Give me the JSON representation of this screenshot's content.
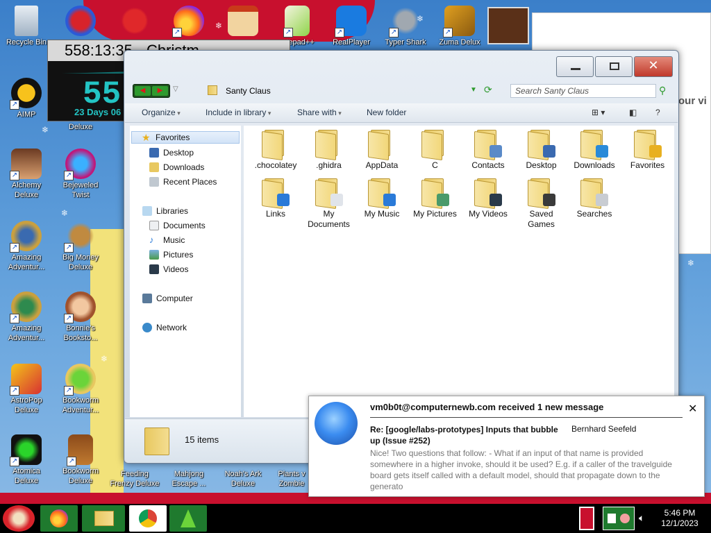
{
  "desktop": {
    "icons": [
      {
        "label": "Recycle Bin"
      },
      {
        "label": "AIMP"
      },
      {
        "label": "Alchemy Deluxe"
      },
      {
        "label": "Amazing Adventur..."
      },
      {
        "label": "Amazing Adventur..."
      },
      {
        "label": "AstroPop Deluxe"
      },
      {
        "label": "Atomica Deluxe"
      },
      {
        "label": "Bejeweled Twist"
      },
      {
        "label": "Big Money Deluxe"
      },
      {
        "label": "Bonnie's Booksto..."
      },
      {
        "label": "Bookworm Adventur..."
      },
      {
        "label": "Bookworm Deluxe"
      },
      {
        "label": "Feeding Frenzy Deluxe"
      },
      {
        "label": "Mahjong Escape ..."
      },
      {
        "label": "Noah's Ark Deluxe"
      },
      {
        "label": "Plants v Zombie"
      },
      {
        "label": "...tepad++"
      },
      {
        "label": "RealPlayer"
      },
      {
        "label": "Typer Shark"
      },
      {
        "label": "Zuma Delux"
      },
      {
        "label": "Deluxe"
      }
    ],
    "countdown": {
      "timer": "558:13:35",
      "title": "Christm",
      "big": "55",
      "days": "23 Days 06"
    },
    "side_window_text": "our vi"
  },
  "explorer": {
    "path": "Santy Claus",
    "search_placeholder": "Search Santy Claus",
    "toolbar": {
      "organize": "Organize",
      "include": "Include in library",
      "share": "Share with",
      "new_folder": "New folder"
    },
    "nav": {
      "favorites": "Favorites",
      "desktop": "Desktop",
      "downloads": "Downloads",
      "recent": "Recent Places",
      "libraries": "Libraries",
      "documents": "Documents",
      "music": "Music",
      "pictures": "Pictures",
      "videos": "Videos",
      "computer": "Computer",
      "network": "Network"
    },
    "folders": [
      ".chocolatey",
      ".ghidra",
      "AppData",
      "C",
      "Contacts",
      "Desktop",
      "Downloads",
      "Favorites",
      "Links",
      "My Documents",
      "My Music",
      "My Pictures",
      "My Videos",
      "Saved Games",
      "Searches"
    ],
    "status": "15 items"
  },
  "toast": {
    "header": "vm0b0t@computernewb.com received 1 new message",
    "subject": "Re: [google/labs-prototypes] Inputs that bubble up (Issue #252)",
    "from": "Bernhard Seefeld",
    "body": "Nice! Two questions that follow: - What if an input of that name is provided somewhere in a higher invoke, should it be used? E.g. if a caller of the travelguide board gets itself called with a default model, should that propagate down to the generato"
  },
  "taskbar": {
    "time": "5:46 PM",
    "date": "12/1/2023"
  },
  "colors": {
    "accent_red": "#c8102e",
    "countdown_teal": "#23c4c4",
    "folder_yellow": "#f2d77a"
  }
}
